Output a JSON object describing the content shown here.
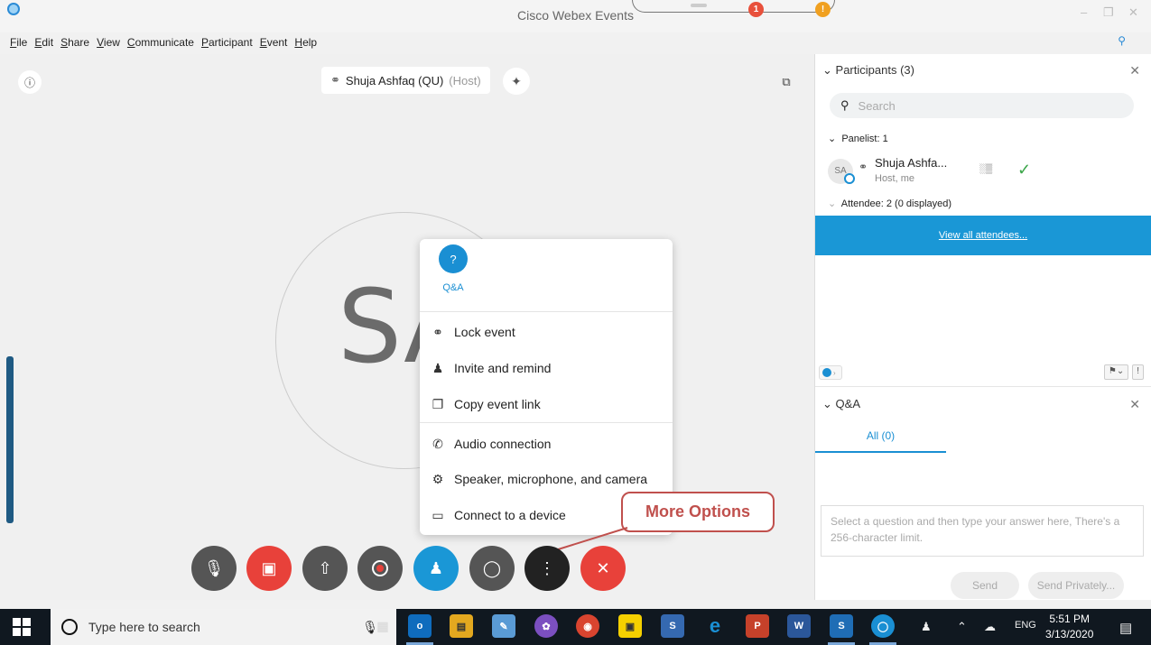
{
  "window": {
    "title": "Cisco Webex Events",
    "notch_badge_count": "1",
    "notch_warning": "!"
  },
  "menu": [
    "File",
    "Edit",
    "Share",
    "View",
    "Communicate",
    "Participant",
    "Event",
    "Help"
  ],
  "stage": {
    "speaker_name": "Shuja Ashfaq (QU)",
    "speaker_role": "(Host)",
    "avatar_initials": "SA"
  },
  "popup": {
    "qa_label": "Q&A",
    "items": [
      {
        "label": "Lock event",
        "icon": "lock-icon"
      },
      {
        "label": "Invite and remind",
        "icon": "add-person-icon"
      },
      {
        "label": "Copy event link",
        "icon": "copy-icon"
      },
      {
        "label": "Audio connection",
        "icon": "phone-icon"
      },
      {
        "label": "Speaker, microphone, and camera",
        "icon": "gear-icon"
      },
      {
        "label": "Connect to a device",
        "icon": "cast-icon"
      }
    ]
  },
  "callout": {
    "text": "More Options"
  },
  "controls": [
    {
      "name": "mute-button",
      "color": "#555555"
    },
    {
      "name": "video-button",
      "color": "#e8413a"
    },
    {
      "name": "share-button",
      "color": "#555555"
    },
    {
      "name": "record-button",
      "color": "#555555"
    },
    {
      "name": "participants-button",
      "color": "#1a97d6"
    },
    {
      "name": "chat-button",
      "color": "#555555"
    },
    {
      "name": "more-options-button",
      "color": "#222222"
    },
    {
      "name": "leave-button",
      "color": "#e8413a"
    }
  ],
  "participants": {
    "header": "Participants (3)",
    "search_placeholder": "Search",
    "panelist_group": "Panelist: 1",
    "panelist": {
      "initials": "SA",
      "name": "Shuja Ashfa...",
      "role": "Host, me"
    },
    "attendee_group": "Attendee: 2 (0 displayed)",
    "view_all": "View all attendees..."
  },
  "qa": {
    "header": "Q&A",
    "tab": "All (0)",
    "answer_placeholder": "Select a question and then type your answer here, There's a 256-character limit.",
    "send": "Send",
    "send_privately": "Send Privately..."
  },
  "taskbar": {
    "search_placeholder": "Type here to search",
    "lang": "ENG",
    "time": "5:51 PM",
    "date": "3/13/2020"
  }
}
